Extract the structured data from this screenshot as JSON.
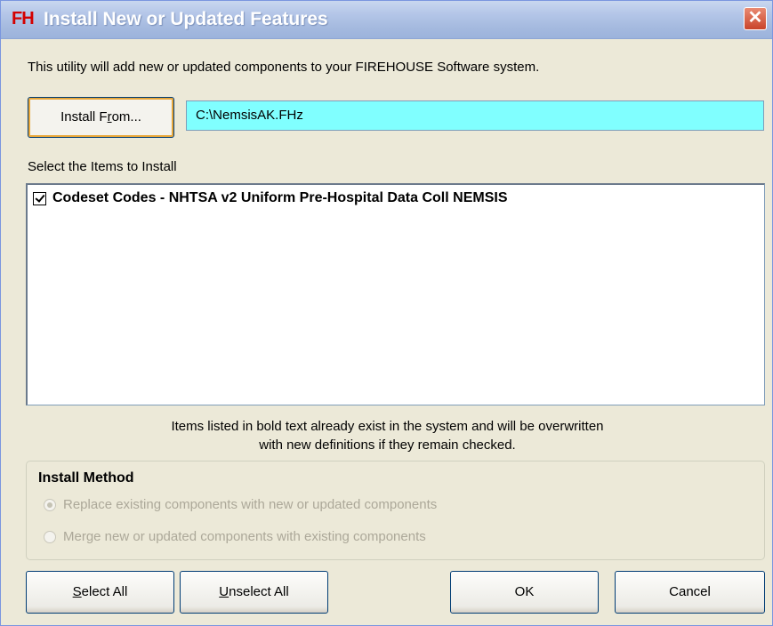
{
  "window": {
    "logo": "FH",
    "title": "Install New or Updated Features",
    "close_label": "✕"
  },
  "intro_text": "This utility will add new or updated components to your FIREHOUSE Software system.",
  "install_from": {
    "label_prefix": "Install F",
    "label_mnemonic": "r",
    "label_suffix": "om...",
    "path_value": "C:\\NemsisAK.FHz"
  },
  "items_section": {
    "label": "Select the Items to Install",
    "items": [
      {
        "label": "Codeset Codes - NHTSA v2 Uniform Pre-Hospital Data Coll NEMSIS",
        "checked": true
      }
    ]
  },
  "note": {
    "line1": "Items listed in bold text already exist in the system and will be overwritten",
    "line2": "with new definitions if they remain checked."
  },
  "install_method": {
    "title": "Install Method",
    "options": [
      {
        "label": "Replace existing components with new or updated components",
        "selected": true,
        "enabled": false
      },
      {
        "label": "Merge new or updated components with existing components",
        "selected": false,
        "enabled": false
      }
    ]
  },
  "buttons": {
    "select_all_mnemonic": "S",
    "select_all_rest": "elect All",
    "unselect_all_mnemonic": "U",
    "unselect_all_rest": "nselect All",
    "ok": "OK",
    "cancel": "Cancel"
  },
  "colors": {
    "path_background": "#80ffff",
    "logo": "#d40000",
    "dialog_background": "#ece9d8"
  }
}
